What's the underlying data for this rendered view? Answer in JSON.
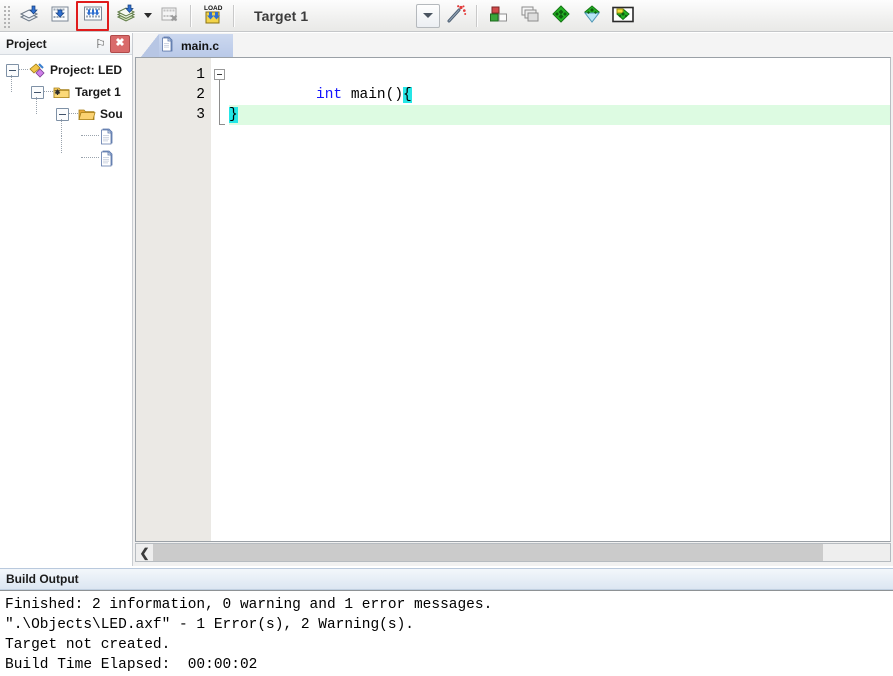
{
  "toolbar": {
    "buttons": [
      {
        "name": "translate-icon",
        "title": "Translate"
      },
      {
        "name": "build-icon",
        "title": "Build"
      },
      {
        "name": "rebuild-icon",
        "title": "Rebuild",
        "selected": true
      },
      {
        "name": "batch-build-icon",
        "title": "Batch Build"
      },
      {
        "name": "stop-build-icon",
        "title": "Stop Build"
      },
      {
        "name": "download-icon",
        "title": "Download",
        "label": "LOAD"
      }
    ],
    "right_buttons": [
      {
        "name": "magic-wand-icon",
        "title": "Options for Target"
      },
      {
        "name": "components-icon",
        "title": "Manage Project Items"
      },
      {
        "name": "multi-project-icon",
        "title": "Multi-Project"
      },
      {
        "name": "pack-installer-icon",
        "title": "Pack Installer"
      },
      {
        "name": "software-packs-icon",
        "title": "Select Software Packs"
      },
      {
        "name": "manage-rte-icon",
        "title": "Manage Run-Time Environment"
      }
    ],
    "target_select": {
      "value": "Target 1",
      "options": [
        "Target 1"
      ]
    }
  },
  "project_panel": {
    "title": "Project",
    "pin_glyph": "⚐",
    "close_glyph": "✖",
    "tree": [
      {
        "label": "Project: LED",
        "icon": "project-icon",
        "depth": 0,
        "expanded": true
      },
      {
        "label": "Target 1",
        "icon": "target-folder-icon",
        "depth": 1,
        "expanded": true
      },
      {
        "label": "Sou",
        "icon": "source-group-folder-icon",
        "depth": 2,
        "expanded": true
      },
      {
        "label": "",
        "icon": "source-file-icon",
        "depth": 3,
        "expanded": false
      },
      {
        "label": "",
        "icon": "source-file-icon",
        "depth": 3,
        "expanded": false
      }
    ]
  },
  "editor": {
    "tabs": [
      {
        "label": "main.c",
        "icon": "source-file-icon",
        "active": true
      }
    ],
    "lines": [
      {
        "number": "1",
        "segments": [
          {
            "text": "int",
            "style": "kw"
          },
          {
            "text": " main()",
            "style": "plain"
          },
          {
            "text": "{",
            "style": "brace-hl"
          }
        ],
        "row_highlight": false,
        "fold": "start"
      },
      {
        "number": "2",
        "segments": [],
        "row_highlight": false,
        "fold": "mid"
      },
      {
        "number": "3",
        "segments": [
          {
            "text": "}",
            "style": "brace-hl"
          }
        ],
        "row_highlight": true,
        "fold": "end"
      }
    ]
  },
  "build_output": {
    "title": "Build Output",
    "lines": [
      "Finished: 2 information, 0 warning and 1 error messages.",
      "\".\\Objects\\LED.axf\" - 1 Error(s), 2 Warning(s).",
      "Target not created.",
      "Build Time Elapsed:  00:00:02"
    ]
  },
  "colors": {
    "accent_selected_border": "#e01b1b",
    "brace_highlight": "#25e6e6",
    "modified_line": "#ddfbe2",
    "keyword": "#1414ff",
    "tab_active": "#b9c9e8"
  }
}
